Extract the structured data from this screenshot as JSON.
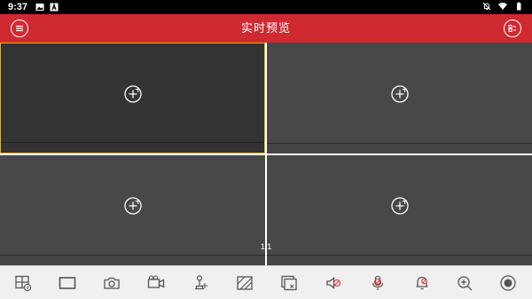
{
  "status_bar": {
    "time": "9:37",
    "left_icons": [
      "image-icon",
      "a-badge-icon"
    ],
    "right_icons": [
      "notifications-off-icon",
      "wifi-icon",
      "battery-icon"
    ]
  },
  "header": {
    "title": "实时预览",
    "background_color": "#cf2a32",
    "left_button_icon": "menu-icon",
    "right_button_icon": "window-layout-icon"
  },
  "live_view": {
    "selected_pane": 1,
    "selected_border_color": "#e7b400",
    "pane_icon": "add-camera-icon",
    "page_indicator": "1/1"
  },
  "toolbar": {
    "icons": [
      "window-split-icon",
      "single-window-icon",
      "snapshot-camera-icon",
      "record-video-icon",
      "ptz-joystick-icon",
      "image-quality-icon",
      "close-all-icon",
      "audio-off-icon",
      "intercom-mic-off-icon",
      "alarm-output-icon",
      "digital-zoom-icon",
      "capture-record-icon"
    ]
  }
}
